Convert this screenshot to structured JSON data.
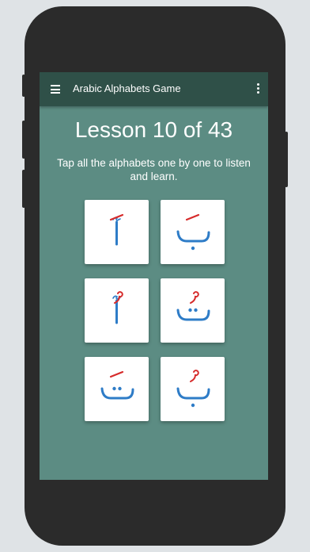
{
  "appbar": {
    "title": "Arabic Alphabets Game",
    "menu_icon": "hamburger-menu-icon",
    "overflow_icon": "more-vert-icon"
  },
  "lesson": {
    "title": "Lesson 10 of 43",
    "instruction": "Tap all the alphabets one by one to listen and learn."
  },
  "cards": [
    {
      "letter": "أَ",
      "base": "alif",
      "mark": "fatha"
    },
    {
      "letter": "بَ",
      "base": "ba",
      "mark": "fatha"
    },
    {
      "letter": "أُ",
      "base": "alif",
      "mark": "damma"
    },
    {
      "letter": "تُ",
      "base": "ta",
      "mark": "damma"
    },
    {
      "letter": "تَ",
      "base": "ta",
      "mark": "fatha"
    },
    {
      "letter": "بُ",
      "base": "ba",
      "mark": "damma"
    }
  ],
  "colors": {
    "background": "#5c8c83",
    "appbar": "#2f5048",
    "letter": "#2e7cc7",
    "diacritic": "#d62b2b",
    "card": "#ffffff"
  }
}
